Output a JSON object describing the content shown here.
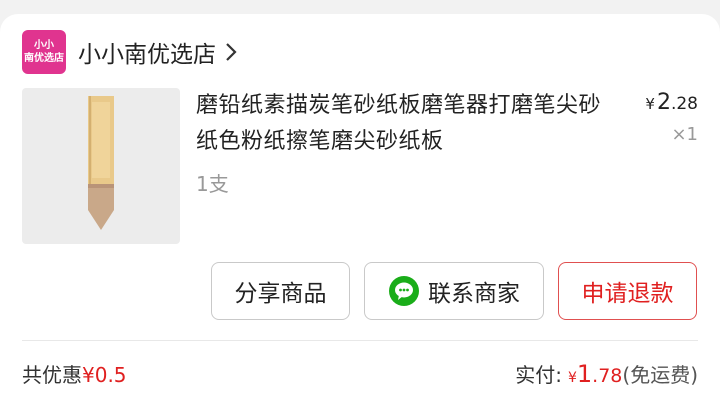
{
  "shop": {
    "logo_line1": "小小",
    "logo_line2": "南优选店",
    "name": "小小南优选店",
    "accent": "#e0348f"
  },
  "product": {
    "title": "磨铅纸素描炭笔砂纸板磨笔器打磨笔尖砂纸色粉纸擦笔磨尖砂纸板",
    "spec": "1支",
    "price_symbol": "¥",
    "price_int": "2",
    "price_dec": ".28",
    "quantity": "×1",
    "image_icon": "sandpaper-pencil-sharpener-image"
  },
  "actions": {
    "share_label": "分享商品",
    "contact_label": "联系商家",
    "refund_label": "申请退款",
    "refund_color": "#e02020"
  },
  "footer": {
    "discount_prefix": "共优惠",
    "discount_value": "¥0.5",
    "paid_label": "实付:",
    "paid_symbol": "¥",
    "paid_int": "1",
    "paid_dec": ".78",
    "paid_note": "(免运费)"
  }
}
